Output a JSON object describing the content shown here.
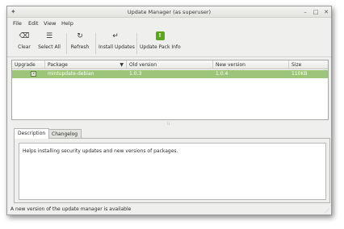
{
  "window": {
    "title": "Update Manager (as superuser)"
  },
  "menu": {
    "file": "File",
    "edit": "Edit",
    "view": "View",
    "help": "Help"
  },
  "toolbar": {
    "clear": "Clear",
    "select_all": "Select All",
    "refresh": "Refresh",
    "install_updates": "Install Updates",
    "update_pack_info": "Update Pack Info"
  },
  "table": {
    "headers": {
      "upgrade": "Upgrade",
      "package": "Package",
      "old_version": "Old version",
      "new_version": "New version",
      "size": "Size"
    },
    "rows": [
      {
        "upgrade_checked": true,
        "package": "mintupdate-debian",
        "old_version": "1.0.3",
        "new_version": "1.0.4",
        "size": "110KB"
      }
    ],
    "selected_row_color": "#9cc47a"
  },
  "tabs": {
    "description": "Description",
    "changelog": "Changelog",
    "active": "Description"
  },
  "description_text": "Helps installing security updates and new versions of packages.",
  "status_text": "A new version of the update manager is available"
}
